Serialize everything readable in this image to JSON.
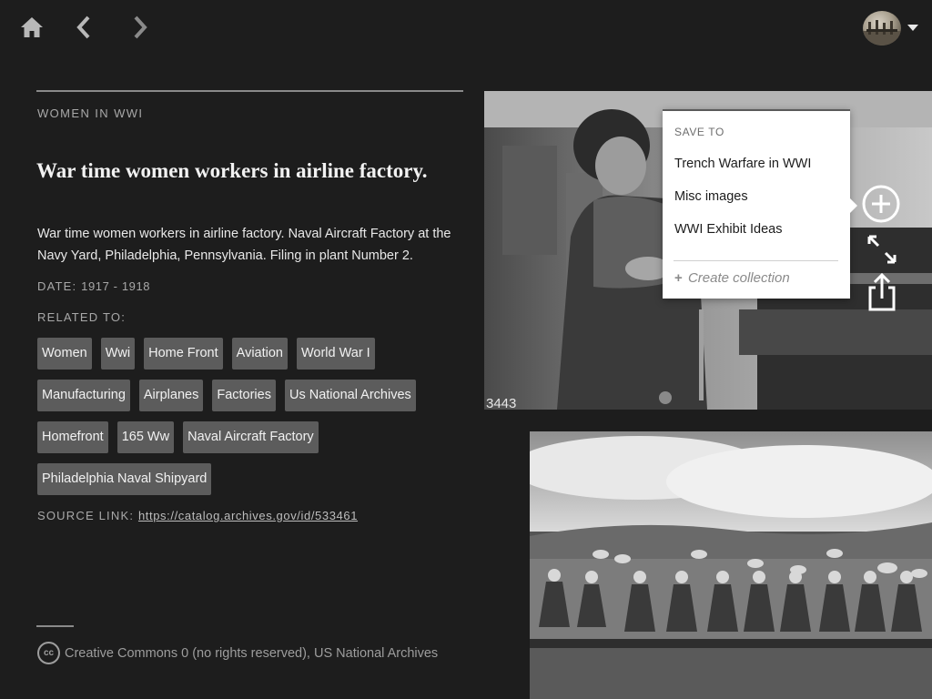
{
  "nav": {
    "home_icon": "home-icon",
    "back_icon": "chevron-left-icon",
    "forward_icon": "chevron-right-icon",
    "account_caret_icon": "caret-down-icon"
  },
  "item": {
    "collection": "WOMEN IN WWI",
    "title": "War time women workers in airline factory.",
    "description": "War time women workers in airline factory. Naval Aircraft Factory at the Navy Yard, Philadelphia, Pennsylvania. Filing in plant Number 2.",
    "date_label": "DATE:",
    "date_value": "1917 - 1918",
    "related_label": "RELATED TO:",
    "tags": [
      "Women",
      "Wwi",
      "Home Front",
      "Aviation",
      "World War I",
      "Manufacturing",
      "Airplanes",
      "Factories",
      "Us National Archives",
      "Homefront",
      "165 Ww",
      "Naval Aircraft Factory",
      "Philadelphia Naval Shipyard"
    ],
    "source_label": "SOURCE LINK:",
    "source_url": "https://catalog.archives.gov/id/533461",
    "license_icon": "cc",
    "license_text": "Creative Commons 0 (no rights reserved), US National Archives"
  },
  "photo1": {
    "caption_number": "3443"
  },
  "actions": {
    "add_icon": "plus-circle-icon",
    "expand_icon": "expand-icon",
    "share_icon": "share-icon"
  },
  "save_menu": {
    "header": "SAVE TO",
    "items": [
      "Trench Warfare in WWI",
      "Misc images",
      "WWI Exhibit Ideas"
    ],
    "create_plus": "+",
    "create_label": "Create collection"
  },
  "colors": {
    "background": "#1d1d1d",
    "tag_bg": "#5c5c5c",
    "muted_text": "#a8a8a8",
    "menu_bg": "#ffffff"
  }
}
